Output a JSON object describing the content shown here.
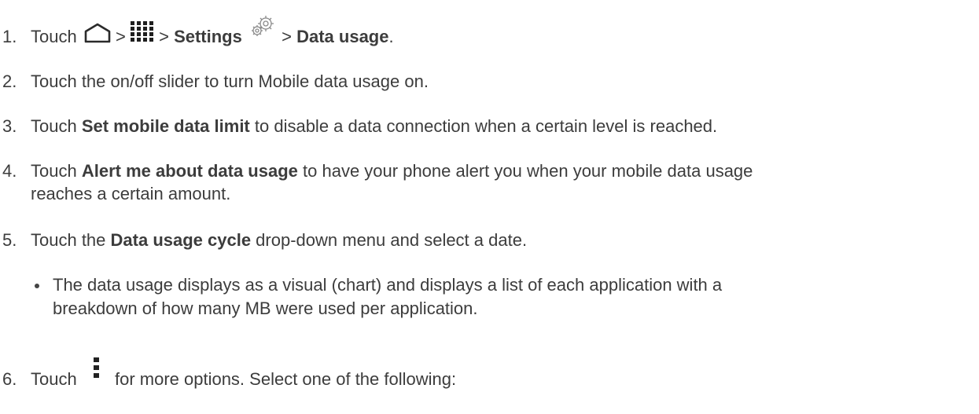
{
  "steps": [
    {
      "num": "1.",
      "pre": "Touch",
      "sep1": ">",
      "sep2": ">",
      "settings": "Settings",
      "sep3": ">",
      "data_usage": "Data usage",
      "end": ".",
      "icons": [
        "home-icon",
        "apps-grid-icon",
        "settings-gear-icon"
      ]
    },
    {
      "num": "2.",
      "text": "Touch the on/off slider to turn Mobile data usage on."
    },
    {
      "num": "3.",
      "pre": "Touch ",
      "bold": "Set mobile data limit",
      "post": " to disable a data connection when a certain level is reached."
    },
    {
      "num": "4.",
      "pre": "Touch ",
      "bold": "Alert me about data usage",
      "post": " to have your phone alert you when your mobile data usage",
      "line2": "reaches a certain amount."
    },
    {
      "num": "5.",
      "pre": "Touch the ",
      "bold": "Data usage cycle",
      "post": " drop-down menu and select a date."
    },
    {
      "num": "6.",
      "pre": "Touch",
      "post": "for more options. Select one of the following:",
      "icon": "overflow-menu-icon"
    }
  ],
  "bullet": {
    "line1": "The data usage displays as a visual (chart) and displays a list of each application with a",
    "line2": "breakdown of how many MB were used per application."
  }
}
